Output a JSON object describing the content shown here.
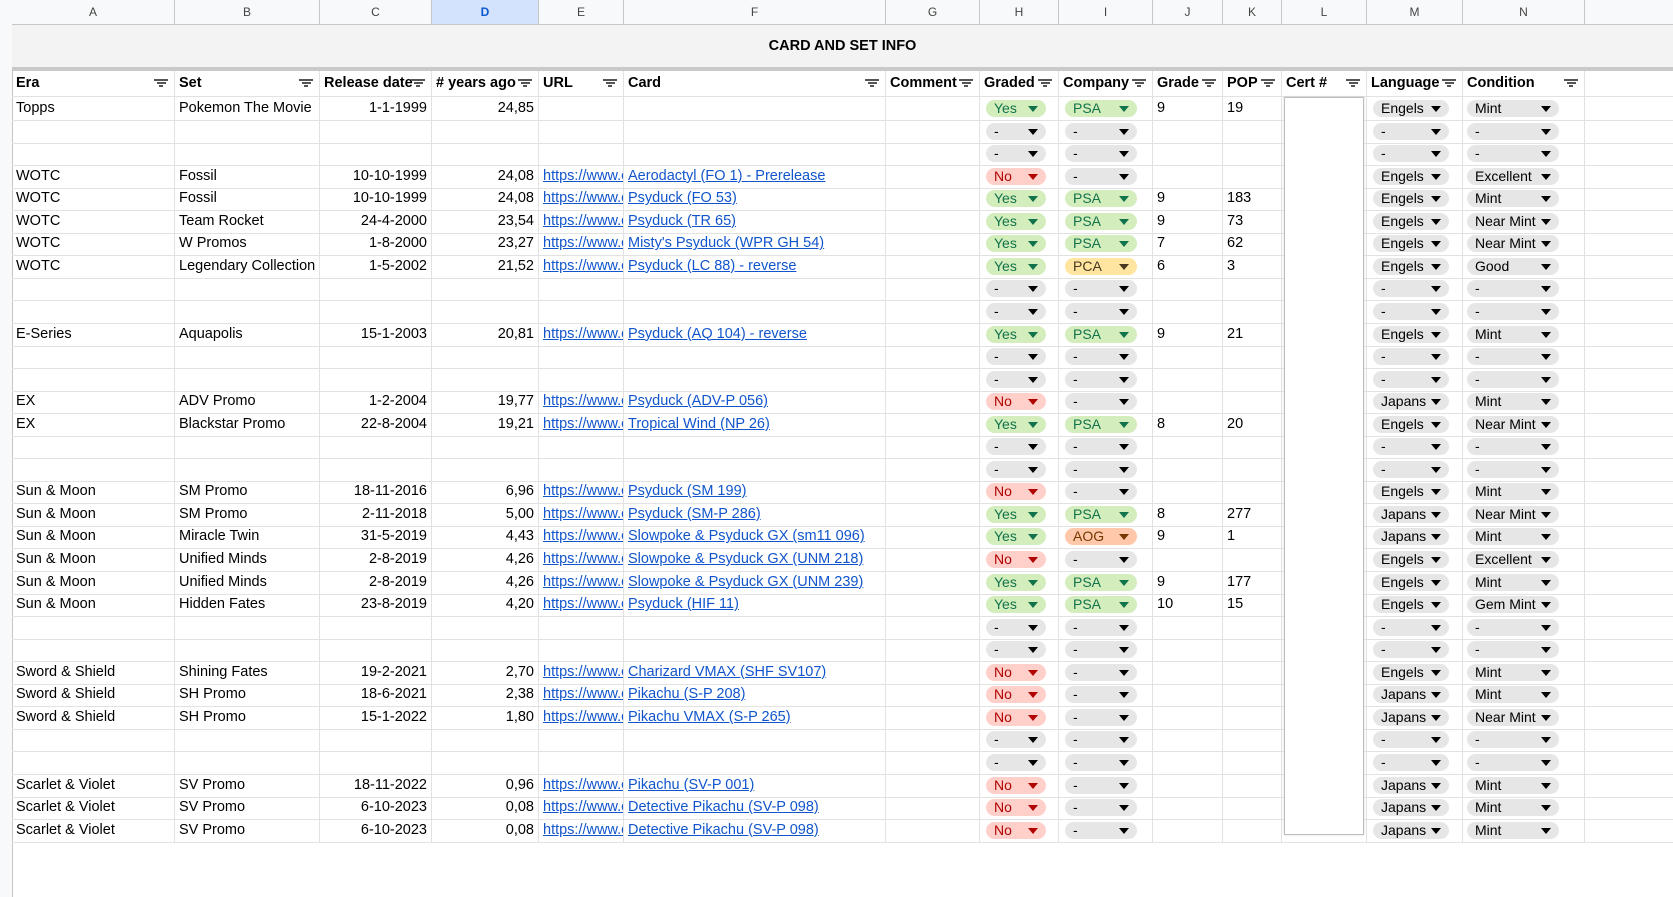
{
  "title": "CARD AND SET INFO",
  "column_letters": [
    "A",
    "B",
    "C",
    "D",
    "E",
    "F",
    "G",
    "H",
    "I",
    "J",
    "K",
    "L",
    "M",
    "N"
  ],
  "selected_column": "D",
  "headers": [
    "Era",
    "Set",
    "Release date",
    "# years ago",
    "URL",
    "Card",
    "Comment",
    "Graded",
    "Company",
    "Grade",
    "POP",
    "Cert #",
    "Language",
    "Condition"
  ],
  "rows": [
    {
      "era": "Topps",
      "set": "Pokemon The Movie",
      "date": "1-1-1999",
      "years": "24,85",
      "url": "",
      "card": "",
      "graded": "Yes",
      "company": "PSA",
      "grade": "9",
      "pop": "19",
      "language": "Engels",
      "condition": "Mint"
    },
    {
      "era": "",
      "set": "",
      "date": "",
      "years": "",
      "url": "",
      "card": "",
      "graded": "-",
      "company": "-",
      "grade": "",
      "pop": "",
      "language": "-",
      "condition": "-"
    },
    {
      "era": "",
      "set": "",
      "date": "",
      "years": "",
      "url": "",
      "card": "",
      "graded": "-",
      "company": "-",
      "grade": "",
      "pop": "",
      "language": "-",
      "condition": "-"
    },
    {
      "era": "WOTC",
      "set": "Fossil",
      "date": "10-10-1999",
      "years": "24,08",
      "url": "https://www.c",
      "card": "Aerodactyl (FO 1) - Prerelease",
      "graded": "No",
      "company": "-",
      "grade": "",
      "pop": "",
      "language": "Engels",
      "condition": "Excellent"
    },
    {
      "era": "WOTC",
      "set": "Fossil",
      "date": "10-10-1999",
      "years": "24,08",
      "url": "https://www.c",
      "card": "Psyduck (FO 53)",
      "graded": "Yes",
      "company": "PSA",
      "grade": "9",
      "pop": "183",
      "language": "Engels",
      "condition": "Mint"
    },
    {
      "era": "WOTC",
      "set": "Team Rocket",
      "date": "24-4-2000",
      "years": "23,54",
      "url": "https://www.c",
      "card": "Psyduck (TR 65)",
      "graded": "Yes",
      "company": "PSA",
      "grade": "9",
      "pop": "73",
      "language": "Engels",
      "condition": "Near Mint"
    },
    {
      "era": "WOTC",
      "set": "W Promos",
      "date": "1-8-2000",
      "years": "23,27",
      "url": "https://www.c",
      "card": "Misty's Psyduck (WPR GH 54)",
      "graded": "Yes",
      "company": "PSA",
      "grade": "7",
      "pop": "62",
      "language": "Engels",
      "condition": "Near Mint"
    },
    {
      "era": "WOTC",
      "set": "Legendary Collection",
      "date": "1-5-2002",
      "years": "21,52",
      "url": "https://www.c",
      "card": "Psyduck (LC 88) - reverse",
      "graded": "Yes",
      "company": "PCA",
      "grade": "6",
      "pop": "3",
      "language": "Engels",
      "condition": "Good"
    },
    {
      "era": "",
      "set": "",
      "date": "",
      "years": "",
      "url": "",
      "card": "",
      "graded": "-",
      "company": "-",
      "grade": "",
      "pop": "",
      "language": "-",
      "condition": "-"
    },
    {
      "era": "",
      "set": "",
      "date": "",
      "years": "",
      "url": "",
      "card": "",
      "graded": "-",
      "company": "-",
      "grade": "",
      "pop": "",
      "language": "-",
      "condition": "-"
    },
    {
      "era": "E-Series",
      "set": "Aquapolis",
      "date": "15-1-2003",
      "years": "20,81",
      "url": "https://www.c",
      "card": "Psyduck (AQ 104) - reverse",
      "graded": "Yes",
      "company": "PSA",
      "grade": "9",
      "pop": "21",
      "language": "Engels",
      "condition": "Mint"
    },
    {
      "era": "",
      "set": "",
      "date": "",
      "years": "",
      "url": "",
      "card": "",
      "graded": "-",
      "company": "-",
      "grade": "",
      "pop": "",
      "language": "-",
      "condition": "-"
    },
    {
      "era": "",
      "set": "",
      "date": "",
      "years": "",
      "url": "",
      "card": "",
      "graded": "-",
      "company": "-",
      "grade": "",
      "pop": "",
      "language": "-",
      "condition": "-"
    },
    {
      "era": "EX",
      "set": "ADV Promo",
      "date": "1-2-2004",
      "years": "19,77",
      "url": "https://www.c",
      "card": "Psyduck (ADV-P 056)",
      "graded": "No",
      "company": "-",
      "grade": "",
      "pop": "",
      "language": "Japans",
      "condition": "Mint"
    },
    {
      "era": "EX",
      "set": "Blackstar Promo",
      "date": "22-8-2004",
      "years": "19,21",
      "url": "https://www.c",
      "card": "Tropical Wind (NP 26)",
      "graded": "Yes",
      "company": "PSA",
      "grade": "8",
      "pop": "20",
      "language": "Engels",
      "condition": "Near Mint"
    },
    {
      "era": "",
      "set": "",
      "date": "",
      "years": "",
      "url": "",
      "card": "",
      "graded": "-",
      "company": "-",
      "grade": "",
      "pop": "",
      "language": "-",
      "condition": "-"
    },
    {
      "era": "",
      "set": "",
      "date": "",
      "years": "",
      "url": "",
      "card": "",
      "graded": "-",
      "company": "-",
      "grade": "",
      "pop": "",
      "language": "-",
      "condition": "-"
    },
    {
      "era": "Sun & Moon",
      "set": "SM Promo",
      "date": "18-11-2016",
      "years": "6,96",
      "url": "https://www.c",
      "card": "Psyduck (SM 199)",
      "graded": "No",
      "company": "-",
      "grade": "",
      "pop": "",
      "language": "Engels",
      "condition": "Mint"
    },
    {
      "era": "Sun & Moon",
      "set": "SM Promo",
      "date": "2-11-2018",
      "years": "5,00",
      "url": "https://www.c",
      "card": "Psyduck (SM-P 286)",
      "graded": "Yes",
      "company": "PSA",
      "grade": "8",
      "pop": "277",
      "language": "Japans",
      "condition": "Near Mint"
    },
    {
      "era": "Sun & Moon",
      "set": "Miracle Twin",
      "date": "31-5-2019",
      "years": "4,43",
      "url": "https://www.c",
      "card": "Slowpoke & Psyduck GX (sm11 096)",
      "graded": "Yes",
      "company": "AOG",
      "grade": "9",
      "pop": "1",
      "language": "Japans",
      "condition": "Mint"
    },
    {
      "era": "Sun & Moon",
      "set": "Unified Minds",
      "date": "2-8-2019",
      "years": "4,26",
      "url": "https://www.c",
      "card": "Slowpoke & Psyduck GX (UNM 218)",
      "graded": "No",
      "company": "-",
      "grade": "",
      "pop": "",
      "language": "Engels",
      "condition": "Excellent"
    },
    {
      "era": "Sun & Moon",
      "set": "Unified Minds",
      "date": "2-8-2019",
      "years": "4,26",
      "url": "https://www.c",
      "card": "Slowpoke & Psyduck GX (UNM 239)",
      "graded": "Yes",
      "company": "PSA",
      "grade": "9",
      "pop": "177",
      "language": "Engels",
      "condition": "Mint"
    },
    {
      "era": "Sun & Moon",
      "set": "Hidden Fates",
      "date": "23-8-2019",
      "years": "4,20",
      "url": "https://www.c",
      "card": "Psyduck (HIF 11)",
      "graded": "Yes",
      "company": "PSA",
      "grade": "10",
      "pop": "15",
      "language": "Engels",
      "condition": "Gem Mint"
    },
    {
      "era": "",
      "set": "",
      "date": "",
      "years": "",
      "url": "",
      "card": "",
      "graded": "-",
      "company": "-",
      "grade": "",
      "pop": "",
      "language": "-",
      "condition": "-"
    },
    {
      "era": "",
      "set": "",
      "date": "",
      "years": "",
      "url": "",
      "card": "",
      "graded": "-",
      "company": "-",
      "grade": "",
      "pop": "",
      "language": "-",
      "condition": "-"
    },
    {
      "era": "Sword & Shield",
      "set": "Shining Fates",
      "date": "19-2-2021",
      "years": "2,70",
      "url": "https://www.c",
      "card": "Charizard VMAX (SHF SV107)",
      "graded": "No",
      "company": "-",
      "grade": "",
      "pop": "",
      "language": "Engels",
      "condition": "Mint"
    },
    {
      "era": "Sword & Shield",
      "set": "SH Promo",
      "date": "18-6-2021",
      "years": "2,38",
      "url": "https://www.c",
      "card": "Pikachu (S-P 208)",
      "graded": "No",
      "company": "-",
      "grade": "",
      "pop": "",
      "language": "Japans",
      "condition": "Mint"
    },
    {
      "era": "Sword & Shield",
      "set": "SH Promo",
      "date": "15-1-2022",
      "years": "1,80",
      "url": "https://www.c",
      "card": "Pikachu VMAX (S-P 265)",
      "graded": "No",
      "company": "-",
      "grade": "",
      "pop": "",
      "language": "Japans",
      "condition": "Near Mint"
    },
    {
      "era": "",
      "set": "",
      "date": "",
      "years": "",
      "url": "",
      "card": "",
      "graded": "-",
      "company": "-",
      "grade": "",
      "pop": "",
      "language": "-",
      "condition": "-"
    },
    {
      "era": "",
      "set": "",
      "date": "",
      "years": "",
      "url": "",
      "card": "",
      "graded": "-",
      "company": "-",
      "grade": "",
      "pop": "",
      "language": "-",
      "condition": "-"
    },
    {
      "era": "Scarlet & Violet",
      "set": "SV Promo",
      "date": "18-11-2022",
      "years": "0,96",
      "url": "https://www.c",
      "card": "Pikachu (SV-P 001)",
      "graded": "No",
      "company": "-",
      "grade": "",
      "pop": "",
      "language": "Japans",
      "condition": "Mint"
    },
    {
      "era": "Scarlet & Violet",
      "set": "SV Promo",
      "date": "6-10-2023",
      "years": "0,08",
      "url": "https://www.c",
      "card": "Detective Pikachu (SV-P 098)",
      "graded": "No",
      "company": "-",
      "grade": "",
      "pop": "",
      "language": "Japans",
      "condition": "Mint"
    },
    {
      "era": "Scarlet & Violet",
      "set": "SV Promo",
      "date": "6-10-2023",
      "years": "0,08",
      "url": "https://www.c",
      "card": "Detective Pikachu (SV-P 098)",
      "graded": "No",
      "company": "-",
      "grade": "",
      "pop": "",
      "language": "Japans",
      "condition": "Mint"
    }
  ],
  "chip_colors": {
    "Yes": "green",
    "No": "red",
    "PSA": "green",
    "PCA": "orange",
    "AOG": "salmon",
    "-": "gray"
  }
}
